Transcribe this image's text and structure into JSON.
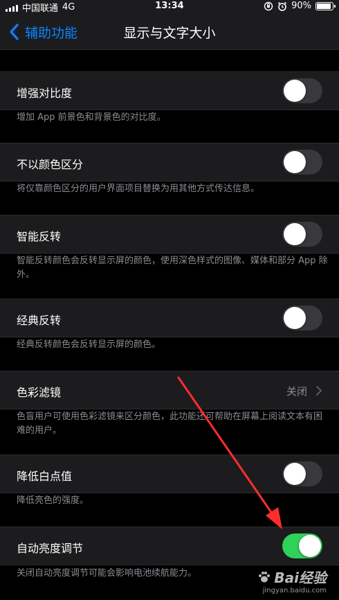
{
  "status_bar": {
    "carrier": "中国联通",
    "network": "4G",
    "time": "13:34",
    "battery_percent": "90%",
    "battery_level": 0.9
  },
  "nav": {
    "back_label": "辅助功能",
    "title": "显示与文字大小"
  },
  "settings": [
    {
      "label": "增强对比度",
      "footer": "增加 App 前景色和背景色的对比度。",
      "toggle_on": false
    },
    {
      "label": "不以颜色区分",
      "footer": "将仅靠颜色区分的用户界面项目替换为用其他方式传达信息。",
      "toggle_on": false
    },
    {
      "label": "智能反转",
      "footer": "智能反转颜色会反转显示屏的颜色，使用深色样式的图像、媒体和部分 App 除外。",
      "toggle_on": false
    },
    {
      "label": "经典反转",
      "footer": "经典反转颜色会反转显示屏的颜色。",
      "toggle_on": false
    },
    {
      "label": "色彩滤镜",
      "value": "关闭",
      "footer": "色盲用户可使用色彩滤镜来区分颜色，此功能还可帮助在屏幕上阅读文本有困难的用户。"
    },
    {
      "label": "降低白点值",
      "footer": "降低亮色的强度。",
      "toggle_on": false
    },
    {
      "label": "自动亮度调节",
      "footer": "关闭自动亮度调节可能会影响电池续航能力。",
      "toggle_on": true
    }
  ],
  "watermark": {
    "logo": "Bai经验",
    "url": "jingyan.baidu.com"
  },
  "colors": {
    "accent": "#0a84ff",
    "toggle_on": "#30d158",
    "toggle_off": "#39393d",
    "annotation_arrow": "#ff2d2d"
  }
}
